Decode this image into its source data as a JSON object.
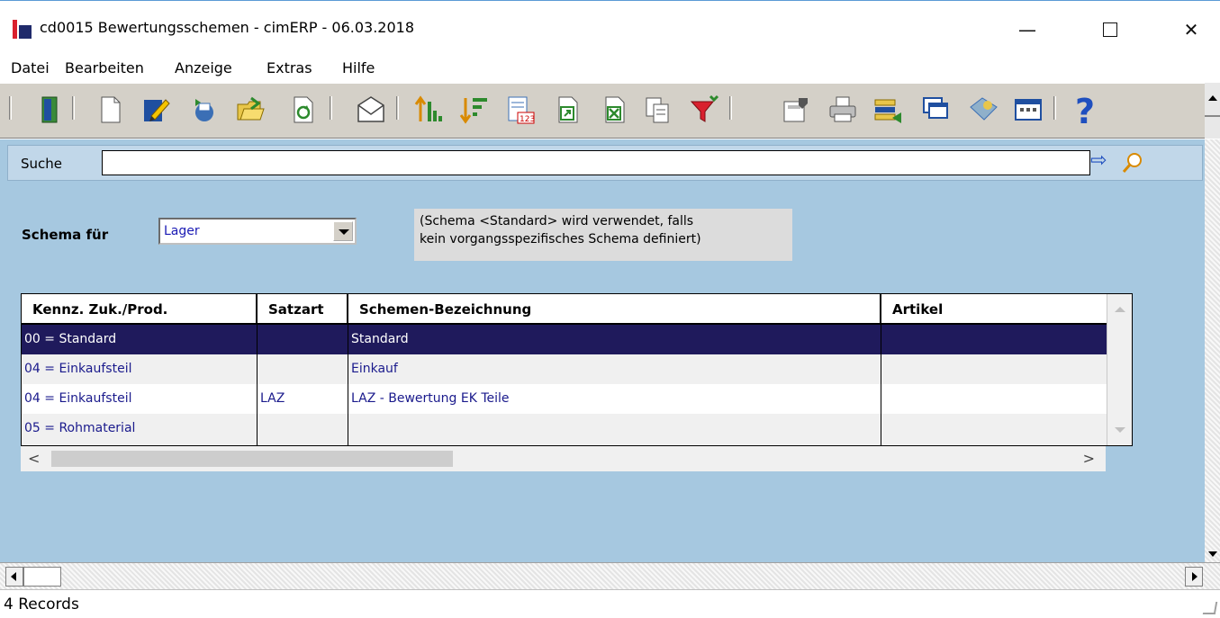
{
  "window": {
    "title": "cd0015 Bewertungsschemen - cimERP - 06.03.2018",
    "minimize_glyph": "—",
    "close_glyph": "✕"
  },
  "menu": [
    "Datei",
    "Bearbeiten",
    "Anzeige",
    "Extras",
    "Hilfe"
  ],
  "toolbar": {
    "buttons": [
      {
        "icon": "exit-door-icon"
      },
      {
        "icon": "new-document-icon"
      },
      {
        "icon": "edit-pencil-icon"
      },
      {
        "icon": "copy-record-icon"
      },
      {
        "icon": "open-folder-icon"
      },
      {
        "icon": "refresh-icon"
      },
      {
        "icon": "mail-envelope-icon"
      },
      {
        "icon": "sort-ascending-icon"
      },
      {
        "icon": "sort-descending-icon"
      },
      {
        "icon": "number-list-icon"
      },
      {
        "icon": "export-icon"
      },
      {
        "icon": "excel-export-icon"
      },
      {
        "icon": "copy-pages-icon"
      },
      {
        "icon": "filter-funnel-icon"
      },
      {
        "icon": "edit-form-icon"
      },
      {
        "icon": "printer-icon"
      },
      {
        "icon": "transfer-icon"
      },
      {
        "icon": "windows-icon"
      },
      {
        "icon": "tag-icon"
      },
      {
        "icon": "table-view-icon"
      },
      {
        "icon": "help-question-icon"
      }
    ]
  },
  "search": {
    "label": "Suche",
    "value": "",
    "go_glyph": "⇨"
  },
  "schema": {
    "label": "Schema für",
    "selected": "Lager",
    "note_line1": "(Schema <Standard> wird verwendet, falls",
    "note_line2": "kein vorgangsspezifisches Schema definiert)"
  },
  "grid": {
    "columns": [
      "Kennz. Zuk./Prod.",
      "Satzart",
      "Schemen-Bezeichnung",
      "Artikel"
    ],
    "rows": [
      {
        "kennz": "00 = Standard",
        "satzart": "",
        "bezeichnung": "Standard",
        "artikel": ""
      },
      {
        "kennz": "04 = Einkaufsteil",
        "satzart": "",
        "bezeichnung": "Einkauf",
        "artikel": ""
      },
      {
        "kennz": "04 = Einkaufsteil",
        "satzart": "LAZ",
        "bezeichnung": "LAZ - Bewertung EK Teile",
        "artikel": ""
      },
      {
        "kennz": "05 = Rohmaterial",
        "satzart": "",
        "bezeichnung": "",
        "artikel": ""
      }
    ],
    "hscroll_left": "<",
    "hscroll_right": ">"
  },
  "status": {
    "text": "4 Records"
  },
  "colors": {
    "client_bg": "#a6c8e0",
    "selected_row": "#1f1a5c",
    "row_text": "#1a1a8c"
  }
}
